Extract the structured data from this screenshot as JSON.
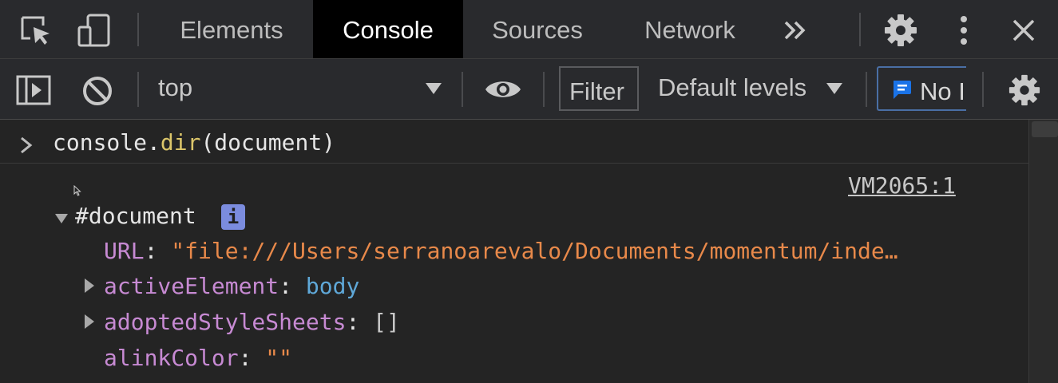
{
  "tabs": [
    {
      "label": "Elements"
    },
    {
      "label": "Console"
    },
    {
      "label": "Sources"
    },
    {
      "label": "Network"
    }
  ],
  "toolbar": {
    "context": "top",
    "filter_placeholder": "Filter",
    "levels": "Default levels",
    "issues": "No I"
  },
  "console": {
    "input": {
      "obj": "console",
      "dot": ".",
      "fn": "dir",
      "args": "(document)"
    },
    "source_link": "VM2065:1",
    "root": "#document",
    "info_badge": "i",
    "props": [
      {
        "key": "URL",
        "sep": ": ",
        "value": "\"file:///Users/serranoarevalo/Documents/momentum/inde…",
        "kind": "str"
      },
      {
        "key": "activeElement",
        "sep": ": ",
        "value": "body",
        "kind": "obj"
      },
      {
        "key": "adoptedStyleSheets",
        "sep": ": ",
        "value": "[]",
        "kind": "arr"
      },
      {
        "key": "alinkColor",
        "sep": ": ",
        "value": "\"\"",
        "kind": "str"
      }
    ]
  },
  "colors": {
    "key": "#c78ad3",
    "string": "#e8894a",
    "object": "#5fa8d8",
    "function": "#dcc66a",
    "accent": "#1a73e8"
  }
}
